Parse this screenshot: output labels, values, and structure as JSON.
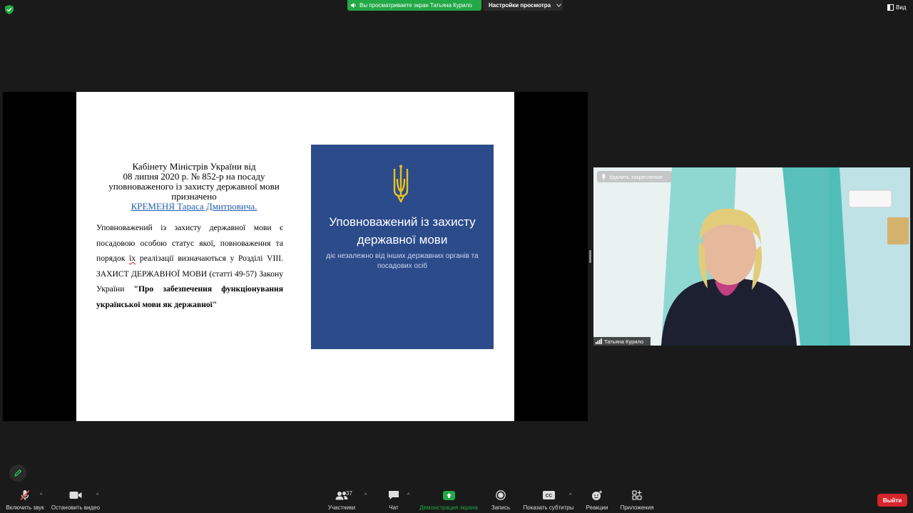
{
  "top_bar": {
    "sharing_banner": "Вы просматриваете экран Татьяна Курило",
    "view_settings_label": "Настройки просмотра",
    "view_label": "Вид"
  },
  "slide": {
    "heading": {
      "line1": "Кабінету Міністрів України від",
      "line2": "08 липня 2020 р. № 852-р на посаду",
      "line3": "уповноваженого із захисту державної мови",
      "line4": "призначено",
      "name_link": "КРЕМЕНЯ Тараса Дмитровича."
    },
    "body": {
      "part1": "Уповноважений із захисту державної мови є посадовою особою статус якої, повноваження та порядок ",
      "underlined_word": "їх",
      "part2": " реалізації визначаються у Розділі VIII. ЗАХИСТ ДЕРЖАВНОЇ МОВИ (статті 49-57) Закону України ",
      "bold_text": "\"Про забезпечення функціонування української мови як державної\""
    },
    "poster": {
      "title": "Уповноважений із захисту державної мови",
      "subtitle": "діє незалежно від інших державних органів та посадових осіб"
    }
  },
  "video_tile": {
    "unpin_label": "Удалить закрепление",
    "participant_name": "Татьяна Курило"
  },
  "toolbar": {
    "unmute_label": "Включить звук",
    "stop_video_label": "Остановить видео",
    "participants_label": "Участники",
    "participants_count": "37",
    "chat_label": "Чат",
    "share_screen_label": "Демонстрация экрана",
    "record_label": "Запись",
    "captions_label": "Показать субтитры",
    "captions_icon_text": "CC",
    "reactions_label": "Реакции",
    "apps_label": "Приложения",
    "leave_label": "Выйти"
  },
  "colors": {
    "background": "#1a1a1a",
    "banner_green": "#22a846",
    "share_icon_green": "#22a846",
    "leave_red": "#d6252b",
    "poster_blue": "#2c4b8b",
    "trident_gold": "#e8c21c",
    "link_blue": "#1f5fae"
  },
  "icons": [
    "shield-icon",
    "speaker-icon",
    "chevron-down-icon",
    "view-icon",
    "trident-icon",
    "pin-icon",
    "signal-icon",
    "pen-icon",
    "mic-muted-icon",
    "camera-icon",
    "participants-icon",
    "chat-icon",
    "share-screen-icon",
    "record-icon",
    "captions-icon",
    "reactions-icon",
    "apps-icon"
  ]
}
